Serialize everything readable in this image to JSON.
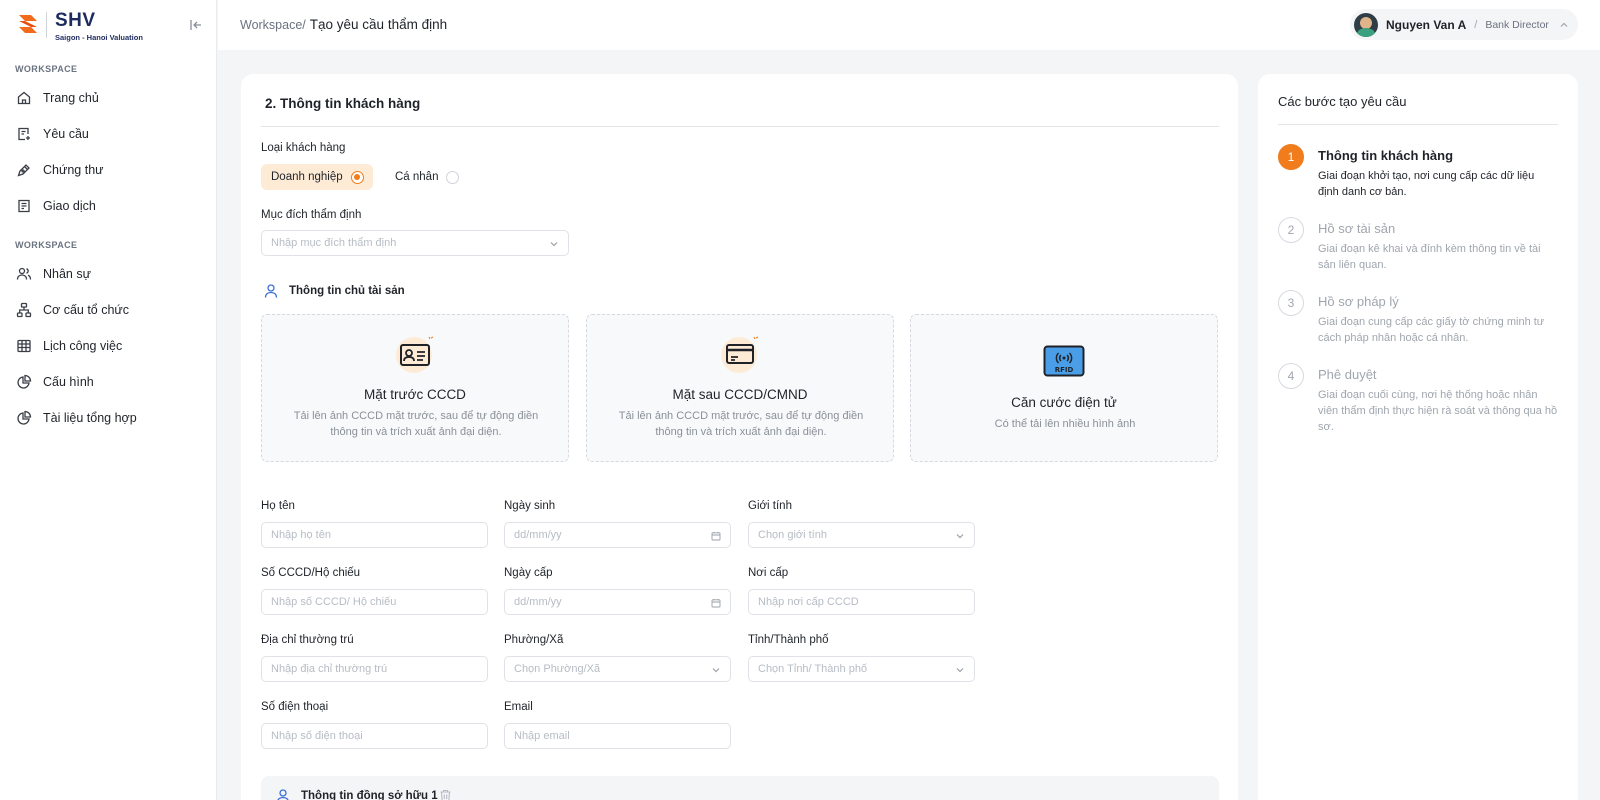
{
  "brand": {
    "name": "SHV",
    "tagline": "Saigon - Hanoi Valuation",
    "accent": "#f07c1c",
    "navy": "#1d2b5e"
  },
  "sidebar": {
    "section1": "WORKSPACE",
    "items1": [
      "Trang chủ",
      "Yêu cầu",
      "Chứng thư",
      "Giao dịch"
    ],
    "section2": "WORKSPACE",
    "items2": [
      "Nhân sự",
      "Cơ cấu tổ chức",
      "Lịch công việc",
      "Cấu hình",
      "Tài liệu tổng hợp"
    ]
  },
  "topbar": {
    "crumb_root": "Workspace/",
    "crumb_current": "Tạo yêu cầu thẩm định",
    "user_name": "Nguyen Van A",
    "user_sep": "/",
    "user_role": "Bank Director"
  },
  "form": {
    "section_title": "2. Thông tin khách hàng",
    "customer_type_label": "Loại khách hàng",
    "type_business": "Doanh nghiệp",
    "type_individual": "Cá nhân",
    "purpose_label": "Mục đích thẩm định",
    "purpose_placeholder": "Nhập mục đích thẩm định",
    "owner_title": "Thông tin chủ tài sản",
    "uploads": [
      {
        "title": "Mặt trước CCCD",
        "desc": "Tải lên ảnh CCCD mặt trước, sau để tự động điền thông tin và trích xuất ảnh đại diện."
      },
      {
        "title": "Mặt sau CCCD/CMND",
        "desc": "Tải lên ảnh CCCD mặt trước, sau để tự động điền thông tin và trích xuất ảnh đại diện."
      },
      {
        "title": "Căn cước điện tử",
        "desc": "Có thể tải lên nhiều hình ảnh"
      }
    ],
    "rfid_text": "RFID",
    "fields": {
      "name_label": "Họ tên",
      "name_ph": "Nhập họ tên",
      "dob_label": "Ngày sinh",
      "dob_ph": "dd/mm/yy",
      "gender_label": "Giới tính",
      "gender_ph": "Chọn giới tính",
      "id_label": "Số CCCD/Hộ chiếu",
      "id_ph": "Nhập số CCCD/ Hộ chiếu",
      "issue_label": "Ngày cấp",
      "issue_ph": "dd/mm/yy",
      "place_label": "Nơi cấp",
      "place_ph": "Nhập nơi cấp CCCD",
      "addr_label": "Địa chỉ thường trú",
      "addr_ph": "Nhập địa chỉ thường trú",
      "ward_label": "Phường/Xã",
      "ward_ph": "Chọn Phường/Xã",
      "city_label": "Tỉnh/Thành phố",
      "city_ph": "Chọn Tỉnh/ Thành phố",
      "phone_label": "Số điện thoại",
      "phone_ph": "Nhập số điện thoại",
      "email_label": "Email",
      "email_ph": "Nhập email"
    },
    "co_owner_title": "Thông tin đồng sở hữu 1"
  },
  "steps": {
    "title": "Các bước tạo yêu cầu",
    "items": [
      {
        "num": "1",
        "title": "Thông tin khách hàng",
        "desc": "Giai đoạn khởi tạo, nơi cung cấp các dữ liệu định danh cơ bản."
      },
      {
        "num": "2",
        "title": "Hồ sơ tài sản",
        "desc": "Giai đoạn kê khai và đính kèm thông tin về tài sản liên quan."
      },
      {
        "num": "3",
        "title": "Hồ sơ pháp lý",
        "desc": "Giai đoạn cung cấp các giấy tờ chứng minh tư cách pháp nhân hoặc cá nhân."
      },
      {
        "num": "4",
        "title": "Phê duyệt",
        "desc": "Giai đoạn cuối cùng, nơi hệ thống hoặc nhân viên thẩm định thực hiện rà soát và thông qua hồ sơ."
      }
    ]
  }
}
